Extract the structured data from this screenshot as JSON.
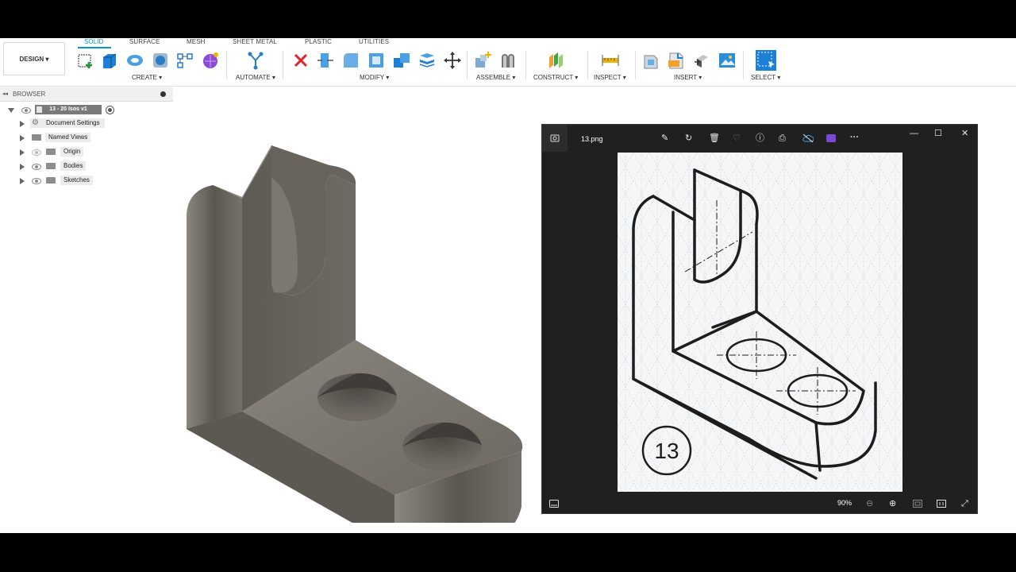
{
  "toolbar": {
    "design_label": "DESIGN ▾",
    "tabs": [
      "SOLID",
      "SURFACE",
      "MESH",
      "SHEET METAL",
      "PLASTIC",
      "UTILITIES"
    ],
    "groups": {
      "create": "CREATE ▾",
      "automate": "AUTOMATE ▾",
      "modify": "MODIFY ▾",
      "assemble": "ASSEMBLE ▾",
      "construct": "CONSTRUCT ▾",
      "inspect": "INSPECT ▾",
      "insert": "INSERT ▾",
      "select": "SELECT ▾"
    },
    "colors": {
      "active_tab": "#0696d7",
      "delete": "#e0252b"
    }
  },
  "browser": {
    "title": "BROWSER",
    "root": "13 - 20 Isos v1",
    "items": [
      {
        "label": "Document Settings",
        "icon": "gear-icon"
      },
      {
        "label": "Named Views",
        "icon": "folder-icon"
      },
      {
        "label": "Origin",
        "icon": "folder-icon"
      },
      {
        "label": "Bodies",
        "icon": "folder-icon"
      },
      {
        "label": "Sketches",
        "icon": "folder-icon"
      }
    ]
  },
  "viewer": {
    "filename": "13.png",
    "zoom": "90%",
    "sketch_number": "13",
    "toolbar_icons": [
      "edit-icon",
      "rotate-icon",
      "delete-icon",
      "favorite-icon",
      "info-icon",
      "print-icon",
      "cloud-icon",
      "clipchamp-icon",
      "more-icon"
    ],
    "window_controls": {
      "minimize": "—",
      "maximize": "☐",
      "close": "✕"
    }
  },
  "model": {
    "color": "#6e6a63"
  }
}
